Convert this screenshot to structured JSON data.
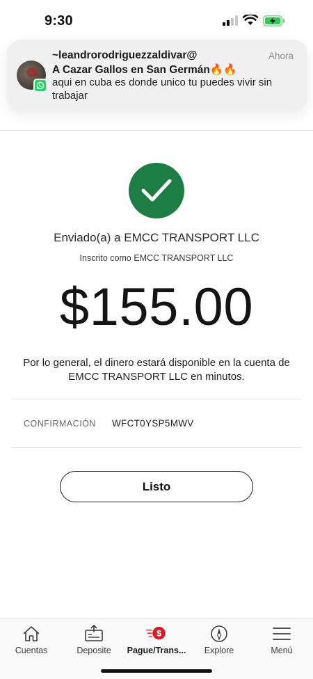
{
  "status_bar": {
    "time": "9:30",
    "icons": [
      "cellular-signal-icon",
      "wifi-icon",
      "battery-charging-icon"
    ],
    "battery_color": "#34c759"
  },
  "notification": {
    "app_icon": "whatsapp-icon",
    "sender": "~leandrorodriguezzaldivar@",
    "title": "A Cazar Gallos  en San Germán🔥🔥",
    "body": "aqui en cuba es donde unico tu puedes vivir sin trabajar",
    "time": "Ahora"
  },
  "confirmation": {
    "success_icon": "checkmark-icon",
    "accent_color": "#1e7d45",
    "sent_to": "Enviado(a) a EMCC TRANSPORT LLC",
    "enrolled_as": "Inscrito como EMCC TRANSPORT LLC",
    "amount": "$155.00",
    "availability_note": "Por lo general, el dinero estará disponible en la cuenta de EMCC TRANSPORT LLC en minutos.",
    "confirmation_label": "CONFIRMACIÓN",
    "confirmation_number": "WFCT0YSP5MWV",
    "done_label": "Listo"
  },
  "tabbar": {
    "active_color": "#d71e28",
    "tabs": [
      {
        "label": "Cuentas",
        "icon": "home-icon",
        "active": false
      },
      {
        "label": "Deposite",
        "icon": "deposit-icon",
        "active": false
      },
      {
        "label": "Pague/Trans...",
        "icon": "pay-transfer-icon",
        "active": true
      },
      {
        "label": "Explore",
        "icon": "compass-icon",
        "active": false
      },
      {
        "label": "Menú",
        "icon": "menu-icon",
        "active": false
      }
    ]
  }
}
